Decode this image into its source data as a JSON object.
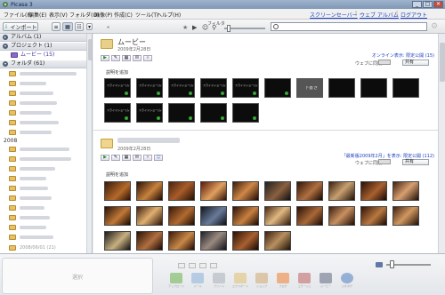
{
  "window": {
    "title": "Picasa 3",
    "minimize": "_",
    "maximize": "□",
    "close": "✕"
  },
  "menu": {
    "items": [
      "ファイル(F)",
      "編集(E)",
      "表示(V)",
      "フォルダ(O)",
      "画像(P)",
      "作成(C)",
      "ツール(T)",
      "ヘルプ(H)"
    ],
    "right_links": [
      "スクリーンセーバー",
      "ウェブ アルバム",
      "ログアウト"
    ]
  },
  "toolbar": {
    "import_label": "インポート",
    "filter_label": "フィルタ",
    "search_placeholder": ""
  },
  "sidebar": {
    "albums": "アルバム (1)",
    "projects": "プロジェクト (1)",
    "project_item": "ムービー (15)",
    "folders": "フォルダ (61)",
    "year": "2008",
    "last_item": "2008/06/01 (21)"
  },
  "album1": {
    "title": "ムービー",
    "date": "2009年2月28日",
    "share_link": "オンライン表示: 限定公開 (15)",
    "web_sync": "ウェブに同期",
    "share_btn": "共有",
    "caption": "説明を追加",
    "thumbs": [
      "スライドショー(ムービー)",
      "スライドショー(ムービー)",
      "スライドショー(ムービー)",
      "スライドショー(ムービー)",
      "スライドショー(ムービー)",
      "",
      "下書き",
      "",
      "",
      "",
      "スライドショー(ムービー)",
      "スライドショー(ムービー)",
      "",
      "",
      ""
    ]
  },
  "album2": {
    "title": "",
    "date": "2009年2月28日",
    "share_link": "「最新版2009年2月」を表示: 限定公開 (112)",
    "web_sync": "ウェブに同期",
    "share_btn": "共有",
    "caption": "説明を追加"
  },
  "tray": {
    "select_label": "選択",
    "icons": [
      "アップロード",
      "メール",
      "プリント",
      "エクスポート",
      "ショップ",
      "ブログ",
      "コラージュ",
      "ムービー",
      "ジオタグ"
    ]
  },
  "colors": {
    "accent": "#1a3fc0",
    "titlebar": "#8aa2c1",
    "thumb_dark": "#0c0c0c"
  }
}
